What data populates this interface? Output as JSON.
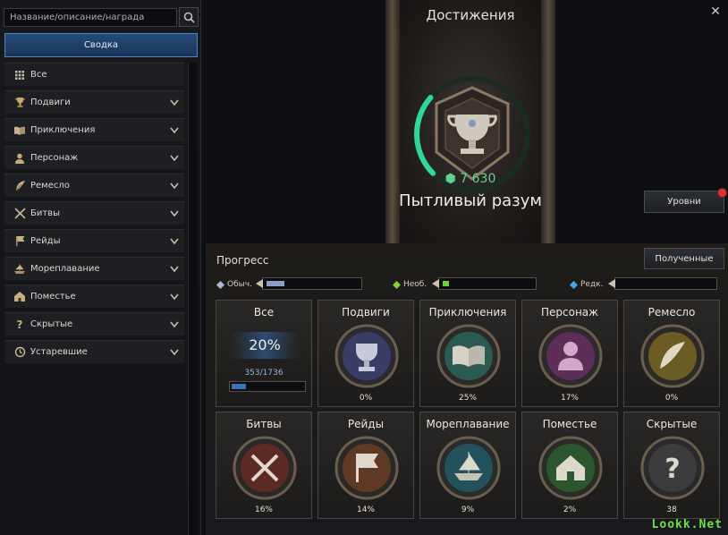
{
  "search": {
    "placeholder": "Название/описание/награда"
  },
  "sidebar": {
    "summary_label": "Сводка",
    "items": [
      {
        "label": "Все",
        "icon": "grid-icon"
      },
      {
        "label": "Подвиги",
        "icon": "trophy-icon"
      },
      {
        "label": "Приключения",
        "icon": "book-icon"
      },
      {
        "label": "Персонаж",
        "icon": "person-icon"
      },
      {
        "label": "Ремесло",
        "icon": "feather-icon"
      },
      {
        "label": "Битвы",
        "icon": "swords-icon"
      },
      {
        "label": "Рейды",
        "icon": "flag-icon"
      },
      {
        "label": "Мореплавание",
        "icon": "ship-icon"
      },
      {
        "label": "Поместье",
        "icon": "estate-icon"
      },
      {
        "label": "Скрытые",
        "icon": "question-icon"
      },
      {
        "label": "Устаревшие",
        "icon": "history-icon"
      }
    ]
  },
  "header": {
    "title": "Достижения",
    "close": "✕"
  },
  "hero": {
    "points": "7 630",
    "name": "Пытливый разум",
    "ring_progress": 0.2
  },
  "buttons": {
    "levels": "Уровни",
    "received": "Полученные"
  },
  "progress": {
    "label": "Прогресс",
    "rarities": [
      {
        "label": "Обыч.",
        "color": "#8aa0c8",
        "fill": 0.2
      },
      {
        "label": "Необ.",
        "color": "#6fcf3a",
        "fill": 0.07
      },
      {
        "label": "Редк.",
        "color": "#4aa6e8",
        "fill": 0.0
      }
    ]
  },
  "cards": {
    "all": {
      "title": "Все",
      "percent": "20%",
      "count": "353/1736",
      "fill": 0.2
    },
    "feats": {
      "title": "Подвиги",
      "percent": "0%"
    },
    "adventures": {
      "title": "Приключения",
      "percent": "25%"
    },
    "character": {
      "title": "Персонаж",
      "percent": "17%"
    },
    "craft": {
      "title": "Ремесло",
      "percent": "0%"
    },
    "battles": {
      "title": "Битвы",
      "percent": "16%"
    },
    "raids": {
      "title": "Рейды",
      "percent": "14%"
    },
    "sailing": {
      "title": "Мореплавание",
      "percent": "9%"
    },
    "estate": {
      "title": "Поместье",
      "percent": "2%"
    },
    "hidden": {
      "title": "Скрытые",
      "percent": "38"
    }
  },
  "watermark": "Lookk.Net"
}
